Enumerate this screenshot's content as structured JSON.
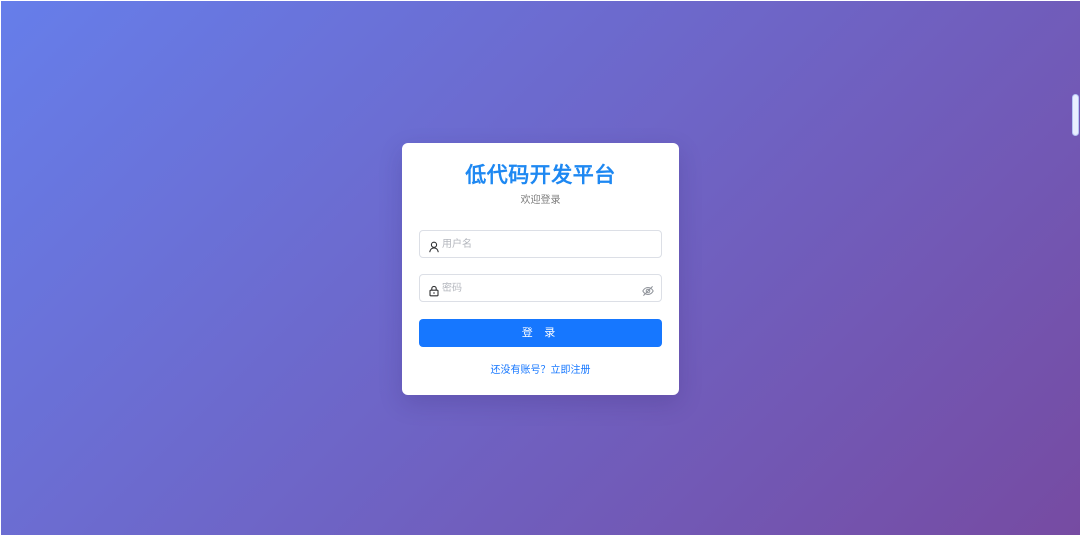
{
  "login": {
    "title": "低代码开发平台",
    "subtitle": "欢迎登录",
    "username": {
      "value": "",
      "placeholder": "用户名",
      "icon": "user-icon"
    },
    "password": {
      "value": "",
      "placeholder": "密码",
      "icon": "lock-icon",
      "toggle_icon": "eye-off-icon"
    },
    "submit_label": "登 录",
    "register_text": "还没有账号？立即注册"
  },
  "colors": {
    "gradient_start": "#667eea",
    "gradient_end": "#764ba2",
    "brand_blue": "#1677ff",
    "title_blue": "#1e88f2"
  }
}
